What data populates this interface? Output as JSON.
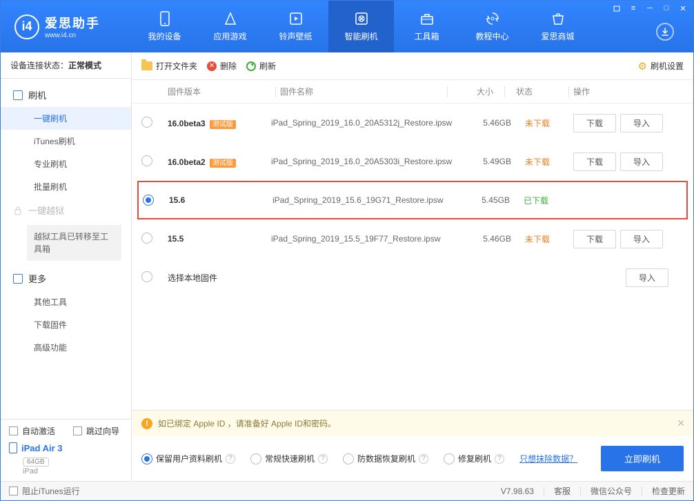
{
  "brand": {
    "name": "爱思助手",
    "site": "www.i4.cn",
    "logo_letter": "i4"
  },
  "nav": [
    {
      "label": "我的设备"
    },
    {
      "label": "应用游戏"
    },
    {
      "label": "铃声壁纸"
    },
    {
      "label": "智能刷机"
    },
    {
      "label": "工具箱"
    },
    {
      "label": "教程中心"
    },
    {
      "label": "爱思商城"
    }
  ],
  "active_nav": 3,
  "sidebar": {
    "conn_label": "设备连接状态：",
    "conn_value": "正常模式",
    "groups": {
      "flash": "刷机",
      "jailbreak": "一键越狱",
      "more": "更多"
    },
    "flash_subs": [
      "一键刷机",
      "iTunes刷机",
      "专业刷机",
      "批量刷机"
    ],
    "flash_active": 0,
    "jailbreak_note": "越狱工具已转移至工具箱",
    "more_subs": [
      "其他工具",
      "下载固件",
      "高级功能"
    ]
  },
  "side_bottom": {
    "auto_activate": "自动激活",
    "skip_guide": "跳过向导",
    "device": "iPad Air 3",
    "capacity": "64GB",
    "device_type": "iPad"
  },
  "toolbar": {
    "open_folder": "打开文件夹",
    "delete": "删除",
    "refresh": "刷新",
    "settings": "刷机设置"
  },
  "columns": {
    "version": "固件版本",
    "name": "固件名称",
    "size": "大小",
    "status": "状态",
    "ops": "操作"
  },
  "beta_badge": "测试版",
  "status_labels": {
    "not_downloaded": "未下载",
    "downloaded": "已下载"
  },
  "op_labels": {
    "download": "下载",
    "import": "导入"
  },
  "local_fw_label": "选择本地固件",
  "firmware": [
    {
      "ver": "16.0beta3",
      "beta": true,
      "name": "iPad_Spring_2019_16.0_20A5312j_Restore.ipsw",
      "size": "5.46GB",
      "status": "not_downloaded",
      "selected": false
    },
    {
      "ver": "16.0beta2",
      "beta": true,
      "name": "iPad_Spring_2019_16.0_20A5303i_Restore.ipsw",
      "size": "5.49GB",
      "status": "not_downloaded",
      "selected": false
    },
    {
      "ver": "15.6",
      "beta": false,
      "name": "iPad_Spring_2019_15.6_19G71_Restore.ipsw",
      "size": "5.45GB",
      "status": "downloaded",
      "selected": true
    },
    {
      "ver": "15.5",
      "beta": false,
      "name": "iPad_Spring_2019_15.5_19F77_Restore.ipsw",
      "size": "5.46GB",
      "status": "not_downloaded",
      "selected": false
    }
  ],
  "warning": "如已绑定 Apple ID ，请准备好 Apple ID和密码。",
  "flash_options": [
    "保留用户资料刷机",
    "常规快速刷机",
    "防数据恢复刷机",
    "修复刷机"
  ],
  "flash_selected": 0,
  "erase_link": "只想抹除数据？",
  "flash_now": "立即刷机",
  "statusbar": {
    "block_itunes": "阻止iTunes运行",
    "version": "V7.98.63",
    "support": "客服",
    "wechat": "微信公众号",
    "update": "检查更新"
  }
}
